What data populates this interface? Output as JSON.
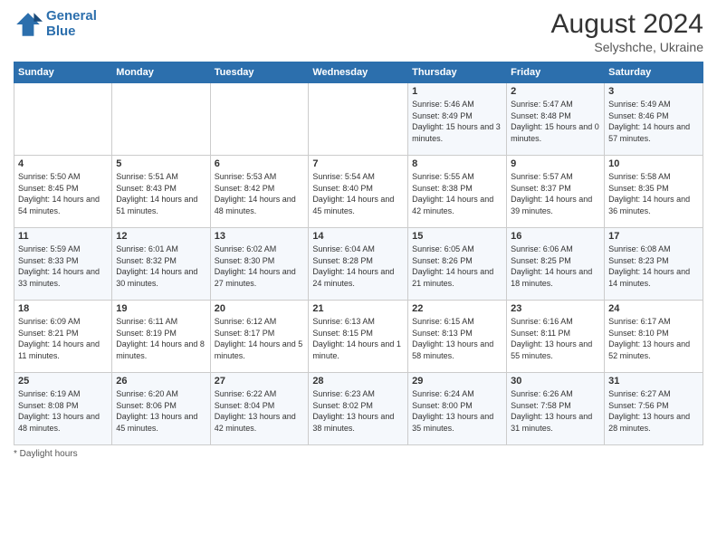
{
  "logo": {
    "line1": "General",
    "line2": "Blue"
  },
  "title": {
    "month_year": "August 2024",
    "location": "Selyshche, Ukraine"
  },
  "days_of_week": [
    "Sunday",
    "Monday",
    "Tuesday",
    "Wednesday",
    "Thursday",
    "Friday",
    "Saturday"
  ],
  "footer": {
    "note": "Daylight hours"
  },
  "weeks": [
    [
      {
        "day": "",
        "info": ""
      },
      {
        "day": "",
        "info": ""
      },
      {
        "day": "",
        "info": ""
      },
      {
        "day": "",
        "info": ""
      },
      {
        "day": "1",
        "info": "Sunrise: 5:46 AM\nSunset: 8:49 PM\nDaylight: 15 hours\nand 3 minutes."
      },
      {
        "day": "2",
        "info": "Sunrise: 5:47 AM\nSunset: 8:48 PM\nDaylight: 15 hours\nand 0 minutes."
      },
      {
        "day": "3",
        "info": "Sunrise: 5:49 AM\nSunset: 8:46 PM\nDaylight: 14 hours\nand 57 minutes."
      }
    ],
    [
      {
        "day": "4",
        "info": "Sunrise: 5:50 AM\nSunset: 8:45 PM\nDaylight: 14 hours\nand 54 minutes."
      },
      {
        "day": "5",
        "info": "Sunrise: 5:51 AM\nSunset: 8:43 PM\nDaylight: 14 hours\nand 51 minutes."
      },
      {
        "day": "6",
        "info": "Sunrise: 5:53 AM\nSunset: 8:42 PM\nDaylight: 14 hours\nand 48 minutes."
      },
      {
        "day": "7",
        "info": "Sunrise: 5:54 AM\nSunset: 8:40 PM\nDaylight: 14 hours\nand 45 minutes."
      },
      {
        "day": "8",
        "info": "Sunrise: 5:55 AM\nSunset: 8:38 PM\nDaylight: 14 hours\nand 42 minutes."
      },
      {
        "day": "9",
        "info": "Sunrise: 5:57 AM\nSunset: 8:37 PM\nDaylight: 14 hours\nand 39 minutes."
      },
      {
        "day": "10",
        "info": "Sunrise: 5:58 AM\nSunset: 8:35 PM\nDaylight: 14 hours\nand 36 minutes."
      }
    ],
    [
      {
        "day": "11",
        "info": "Sunrise: 5:59 AM\nSunset: 8:33 PM\nDaylight: 14 hours\nand 33 minutes."
      },
      {
        "day": "12",
        "info": "Sunrise: 6:01 AM\nSunset: 8:32 PM\nDaylight: 14 hours\nand 30 minutes."
      },
      {
        "day": "13",
        "info": "Sunrise: 6:02 AM\nSunset: 8:30 PM\nDaylight: 14 hours\nand 27 minutes."
      },
      {
        "day": "14",
        "info": "Sunrise: 6:04 AM\nSunset: 8:28 PM\nDaylight: 14 hours\nand 24 minutes."
      },
      {
        "day": "15",
        "info": "Sunrise: 6:05 AM\nSunset: 8:26 PM\nDaylight: 14 hours\nand 21 minutes."
      },
      {
        "day": "16",
        "info": "Sunrise: 6:06 AM\nSunset: 8:25 PM\nDaylight: 14 hours\nand 18 minutes."
      },
      {
        "day": "17",
        "info": "Sunrise: 6:08 AM\nSunset: 8:23 PM\nDaylight: 14 hours\nand 14 minutes."
      }
    ],
    [
      {
        "day": "18",
        "info": "Sunrise: 6:09 AM\nSunset: 8:21 PM\nDaylight: 14 hours\nand 11 minutes."
      },
      {
        "day": "19",
        "info": "Sunrise: 6:11 AM\nSunset: 8:19 PM\nDaylight: 14 hours\nand 8 minutes."
      },
      {
        "day": "20",
        "info": "Sunrise: 6:12 AM\nSunset: 8:17 PM\nDaylight: 14 hours\nand 5 minutes."
      },
      {
        "day": "21",
        "info": "Sunrise: 6:13 AM\nSunset: 8:15 PM\nDaylight: 14 hours\nand 1 minute."
      },
      {
        "day": "22",
        "info": "Sunrise: 6:15 AM\nSunset: 8:13 PM\nDaylight: 13 hours\nand 58 minutes."
      },
      {
        "day": "23",
        "info": "Sunrise: 6:16 AM\nSunset: 8:11 PM\nDaylight: 13 hours\nand 55 minutes."
      },
      {
        "day": "24",
        "info": "Sunrise: 6:17 AM\nSunset: 8:10 PM\nDaylight: 13 hours\nand 52 minutes."
      }
    ],
    [
      {
        "day": "25",
        "info": "Sunrise: 6:19 AM\nSunset: 8:08 PM\nDaylight: 13 hours\nand 48 minutes."
      },
      {
        "day": "26",
        "info": "Sunrise: 6:20 AM\nSunset: 8:06 PM\nDaylight: 13 hours\nand 45 minutes."
      },
      {
        "day": "27",
        "info": "Sunrise: 6:22 AM\nSunset: 8:04 PM\nDaylight: 13 hours\nand 42 minutes."
      },
      {
        "day": "28",
        "info": "Sunrise: 6:23 AM\nSunset: 8:02 PM\nDaylight: 13 hours\nand 38 minutes."
      },
      {
        "day": "29",
        "info": "Sunrise: 6:24 AM\nSunset: 8:00 PM\nDaylight: 13 hours\nand 35 minutes."
      },
      {
        "day": "30",
        "info": "Sunrise: 6:26 AM\nSunset: 7:58 PM\nDaylight: 13 hours\nand 31 minutes."
      },
      {
        "day": "31",
        "info": "Sunrise: 6:27 AM\nSunset: 7:56 PM\nDaylight: 13 hours\nand 28 minutes."
      }
    ]
  ]
}
